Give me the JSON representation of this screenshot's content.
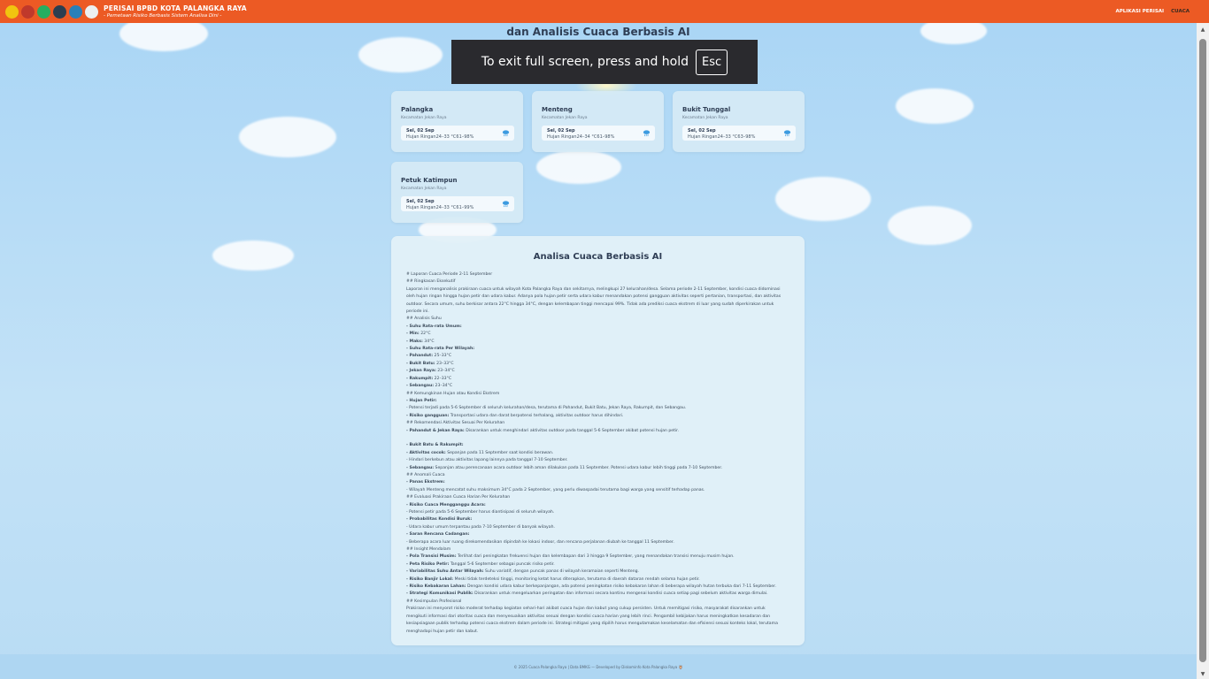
{
  "header": {
    "brand_title": "PERISAI BPBD KOTA PALANGKA RAYA",
    "brand_subtitle": "- Pemetaan Risiko Berbasis Sistem Analisa Dini -",
    "nav": [
      {
        "label": "APLIKASI PERISAI"
      },
      {
        "label": "CUACA"
      }
    ],
    "logo_colors": [
      "#f1c40f",
      "#c0392b",
      "#27ae60",
      "#2c3e50",
      "#2980b9",
      "#ecf0f1"
    ]
  },
  "page_title_line2": "dan Analisis Cuaca Berbasis AI",
  "fullscreen_notice": {
    "text": "To exit full screen, press and hold",
    "key": "Esc"
  },
  "cards": [
    {
      "name": "Palangka",
      "sub": "Kecamatan Jekan Raya",
      "date": "Sel, 02 Sep",
      "condition": "Hujan Ringan24–33 °C61–98%"
    },
    {
      "name": "Menteng",
      "sub": "Kecamatan Jekan Raya",
      "date": "Sel, 02 Sep",
      "condition": "Hujan Ringan24–34 °C61–98%"
    },
    {
      "name": "Bukit Tunggal",
      "sub": "Kecamatan Jekan Raya",
      "date": "Sel, 02 Sep",
      "condition": "Hujan Ringan24–33 °C63–98%"
    },
    {
      "name": "Petuk Katimpun",
      "sub": "Kecamatan Jekan Raya",
      "date": "Sel, 02 Sep",
      "condition": "Hujan Ringan24–33 °C61–99%"
    }
  ],
  "ai": {
    "title": "Analisa Cuaca Berbasis AI",
    "lines": [
      "# Laporan Cuaca Periode 2-11 September",
      "## Ringkasan Eksekutif",
      "Laporan ini menganalisis prakiraan cuaca untuk wilayah Kota Palangka Raya dan sekitarnya, melingkupi 27 kelurahan/desa. Selama periode 2-11 September, kondisi cuaca didominasi",
      "oleh hujan ringan hingga hujan petir dan udara kabur. Adanya pola hujan petir serta udara kabur menandakan potensi gangguan aktivitas seperti pertanian, transportasi, dan aktivitas",
      "outdoor. Secara umum, suhu berkisar antara 22°C hingga 34°C, dengan kelembapan tinggi mencapai 99%. Tidak ada prediksi cuaca ekstrem di luar yang sudah diperkirakan untuk",
      "periode ini.",
      "## Analisis Suhu",
      "- Suhu Rata-rata Umum:",
      "  - Min: 22°C",
      "  - Maks: 34°C",
      "- Suhu Rata-rata Per Wilayah:",
      "  - Pahandut: 25–33°C",
      "  - Bukit Batu: 23–33°C",
      "  - Jekan Raya: 23–34°C",
      "  - Rakumpit: 22–33°C",
      "  - Sebangau: 23–34°C",
      "## Kemungkinan Hujan atau Kondisi Ekstrem",
      "- Hujan Petir:",
      "  - Potensi terjadi pada 5-6 September di seluruh kelurahan/desa, terutama di Pahandut, Bukit Batu, Jekan Raya, Rakumpit, dan Sebangau.",
      "  - Risiko gangguan: Transportasi udara dan darat berpotensi terhalang, aktivitas outdoor harus dihindari.",
      "## Rekomendasi Aktivitas Sesuai Per Kelurahan",
      "- Pahandut & Jekan Raya: Disarankan untuk menghindari aktivitas outdoor pada tanggal 5-6 September akibat potensi hujan petir.",
      " ",
      "- Bukit Batu & Rakumpit:",
      "  - Aktivitas cocok: Sepanjan pada 11 September saat kondisi berawan.",
      "  - Hindari berkebun atau aktivitas lapang lainnya pada tanggal 7-10 September.",
      "- Sebangau: Sepanjan atau perencanaan acara outdoor lebih aman dilakukan pada 11 September. Potensi udara kabur lebih tinggi pada 7-10 September.",
      "## Anomali Cuaca",
      "- Panas Ekstrem:",
      "  - Wilayah Menteng mencatat suhu maksimum 34°C pada 2 September, yang perlu diwaspadai terutama bagi warga yang sensitif terhadap panas.",
      "## Evaluasi Prakiraan Cuaca Harian Per Kelurahan",
      "- Risiko Cuaca Mengganggu Acara:",
      "  - Potensi petir pada 5-6 September harus diantisipasi di seluruh wilayah.",
      "- Probabilitas Kondisi Buruk:",
      "  - Udara kabur umum terpantau pada 7-10 September di banyak wilayah.",
      "- Saran Rencana Cadangan:",
      "  - Beberapa acara luar ruang direkomendasikan dipindah ke lokasi indoor, dan rencana perjalanan diubah ke tanggal 11 September.",
      "## Insight Mendalam",
      "- Pola Transisi Musim: Terlihat dari peningkatan frekuensi hujan dan kelembapan dari 3 hingga 9 September, yang menandakan transisi menuju musim hujan.",
      "- Peta Risiko Petir: Tanggal 5-6 September sebagai puncak risiko petir.",
      "- Variabilitas Suhu Antar Wilayah: Suhu variatif, dengan puncak panas di wilayah keramaian seperti Menteng.",
      "- Risiko Banjir Lokal: Meski tidak terdeteksi tinggi, monitoring ketat harus diterapkan, terutama di daerah dataran rendah selama hujan petir.",
      "- Risiko Kebakaran Lahan: Dengan kondisi udara kabur berkepanjangan, ada potensi peningkatan risiko kebakaran lahan di beberapa wilayah hutan terbuka dari 7-11 September.",
      "- Strategi Komunikasi Publik: Disarankan untuk mengeluarkan peringatan dan informasi secara kontinu mengenai kondisi cuaca setiap pagi sebelum aktivitas warga dimulai.",
      "## Kesimpulan Profesional",
      "Prakiraan ini menyorot risiko moderat terhadap kegiatan sehari-hari akibat cuaca hujan dan kabut yang cukup persisten. Untuk memitigasi risiko, masyarakat disarankan untuk",
      "mengikuti informasi dari otoritas cuaca dan menyesuaikan aktivitas sesuai dengan kondisi cuaca harian yang lebih rinci. Pengambil kebijakan harus meningkatkan kesadaran dan",
      "kesiapsiagaan publik terhadap potensi cuaca ekstrem dalam periode ini. Strategi mitigasi yang dipilih harus mengutamakan keselamatan dan efisiensi sesuai konteks lokal, terutama",
      "menghadapi hujan petir dan kabut."
    ]
  },
  "footer": "© 2025 Cuaca Palangka Raya | Data BMKG — Developed by Diskominfo Kota Palangka Raya 🦉"
}
